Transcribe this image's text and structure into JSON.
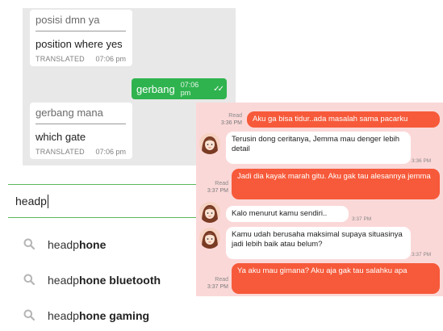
{
  "translate_chat": {
    "messages": [
      {
        "original": "posisi dmn ya",
        "translation": "position where yes",
        "label": "TRANSLATED",
        "time": "07:06 pm"
      },
      {
        "original": "gerbang mana",
        "translation": "which gate",
        "label": "TRANSLATED",
        "time": "07:06 pm"
      }
    ],
    "outgoing": {
      "text": "gerbang",
      "time": "07:06 pm",
      "status_icon": "double-check-icon"
    },
    "colors": {
      "outgoing_bubble": "#2fb34f",
      "background": "#e8e8e8"
    }
  },
  "search": {
    "query": "headp",
    "suggestions": [
      {
        "typed": "headp",
        "completion": "hone"
      },
      {
        "typed": "headp",
        "completion": "hone bluetooth"
      },
      {
        "typed": "headp",
        "completion": "hone gaming"
      }
    ],
    "icon": "search-icon",
    "accent": "#5cb85c"
  },
  "pink_chat": {
    "colors": {
      "background": "#fbd8d8",
      "sent_bubble": "#f65a3a",
      "received_bubble": "#ffffff"
    },
    "read_label": "Read",
    "messages": [
      {
        "dir": "sent",
        "text": "Aku ga bisa tidur..ada masalah sama pacarku",
        "time": "3:36 PM"
      },
      {
        "dir": "recv",
        "text": "Terusin dong ceritanya, Jemma mau denger lebih detail",
        "time": "3:36 PM"
      },
      {
        "dir": "sent",
        "text": "Jadi dia kayak marah gitu. Aku gak tau alesannya jemma",
        "time": "3:37 PM"
      },
      {
        "dir": "recv",
        "text": "Kalo menurut kamu sendiri..",
        "time": "3:37 PM"
      },
      {
        "dir": "recv",
        "text": "Kamu udah berusaha maksimal supaya situasinya jadi lebih baik atau belum?",
        "time": "3:37 PM"
      },
      {
        "dir": "sent",
        "text": "Ya aku mau gimana? Aku aja gak tau salahku apa",
        "time": "3:37 PM"
      }
    ]
  }
}
